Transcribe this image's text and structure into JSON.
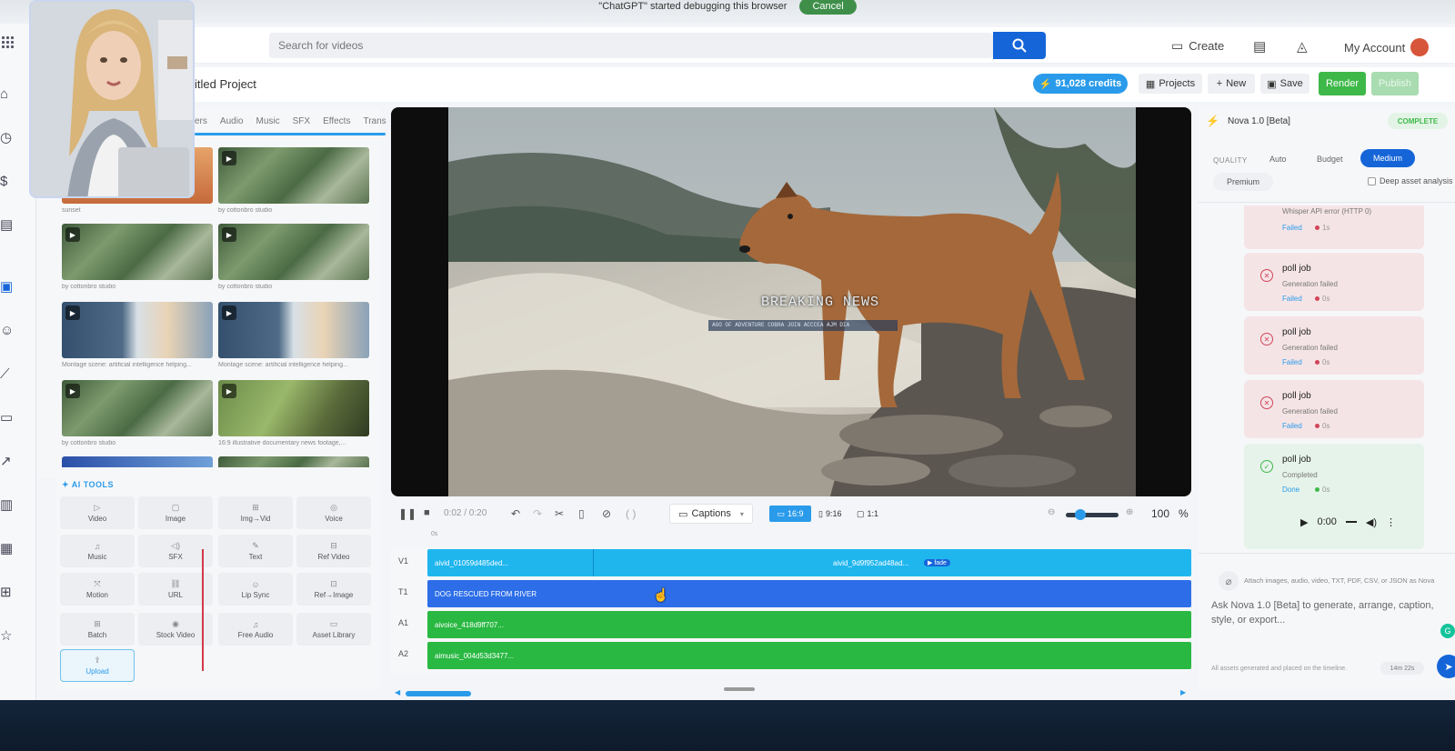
{
  "banner": {
    "text": "\"ChatGPT\" started debugging this browser",
    "cancel": "Cancel"
  },
  "header": {
    "search_placeholder": "Search for videos",
    "create": "Create",
    "my_account": "My Account"
  },
  "project": {
    "title": "itled Project",
    "credits": "91,028 credits",
    "projects": "Projects",
    "new": "New",
    "save": "Save",
    "render": "Render",
    "publish": "Publish"
  },
  "media": {
    "tabs": [
      "ers",
      "Audio",
      "Music",
      "SFX",
      "Effects",
      "Trans"
    ],
    "thumbs": [
      {
        "caption": "sunset"
      },
      {
        "caption": "by cottonbro studio"
      },
      {
        "caption": "by cottonbro studio"
      },
      {
        "caption": "by cottonbro studio"
      },
      {
        "caption": "Montage scene: artificial intelligence helping..."
      },
      {
        "caption": "Montage scene: artificial intelligence helping..."
      },
      {
        "caption": "by cottonbro studio"
      },
      {
        "caption": "16:9 illustrative documentary news footage,..."
      }
    ]
  },
  "ai_tools": {
    "label": "AI TOOLS",
    "tools": [
      {
        "label": "Video",
        "icon": "▷"
      },
      {
        "label": "Image",
        "icon": "▢"
      },
      {
        "label": "Img→Vid",
        "icon": "⊞"
      },
      {
        "label": "Voice",
        "icon": "◎"
      },
      {
        "label": "Music",
        "icon": "♫"
      },
      {
        "label": "SFX",
        "icon": "◁)"
      },
      {
        "label": "Text",
        "icon": "✎"
      },
      {
        "label": "Ref Video",
        "icon": "⊟"
      },
      {
        "label": "Motion",
        "icon": "⤧"
      },
      {
        "label": "URL",
        "icon": "⛓"
      },
      {
        "label": "Lip Sync",
        "icon": "☺"
      },
      {
        "label": "Ref→Image",
        "icon": "⊡"
      },
      {
        "label": "Batch",
        "icon": "⊞"
      },
      {
        "label": "Stock Video",
        "icon": "◉"
      },
      {
        "label": "Free Audio",
        "icon": "♫"
      },
      {
        "label": "Asset Library",
        "icon": "▭"
      }
    ],
    "upload": "Upload"
  },
  "video": {
    "overlay_title": "BREAKING NEWS",
    "overlay_sub": "AGO OF ADVENTURE COBRA JOIN ACCCEA AJM DIA"
  },
  "controls": {
    "time": "0:02 / 0:20",
    "captions": "Captions",
    "ar_169": "16:9",
    "ar_916": "9:16",
    "ar_11": "1:1",
    "zoom": "100",
    "zoom_unit": "%",
    "ruler_start": "0s"
  },
  "timeline": {
    "tracks": [
      {
        "label": "V1",
        "clip": "aivid_01059d485ded...",
        "clip2": "aivid_9d9f952ad48ad...",
        "badge": "fade"
      },
      {
        "label": "T1",
        "clip": "DOG RESCUED FROM RIVER"
      },
      {
        "label": "A1",
        "clip": "aivoice_418d9ff707..."
      },
      {
        "label": "A2",
        "clip": "aimusic_004d53d3477..."
      }
    ]
  },
  "assistant": {
    "name": "Nova 1.0 [Beta]",
    "status": "COMPLETE",
    "quality_label": "QUALITY",
    "quality_options": [
      "Auto",
      "Budget",
      "Medium",
      "Premium"
    ],
    "quality_selected": "Medium",
    "deep_asset": "Deep asset analysis",
    "partial_job": {
      "sub": "Whisper API error (HTTP 0)",
      "status": "Failed",
      "time": "1s"
    },
    "jobs": [
      {
        "title": "poll job",
        "sub": "Generation failed",
        "status": "Failed",
        "time": "0s"
      },
      {
        "title": "poll job",
        "sub": "Generation failed",
        "status": "Failed",
        "time": "0s"
      },
      {
        "title": "poll job",
        "sub": "Generation failed",
        "status": "Failed",
        "time": "0s"
      },
      {
        "title": "poll job",
        "sub": "Completed",
        "status": "Done",
        "time": "0s"
      }
    ],
    "audio_time": "0:00",
    "attach_hint": "Attach images, audio, video, TXT, PDF, CSV, or JSON as Nova",
    "input_placeholder": "Ask Nova 1.0 [Beta] to generate, arrange, caption, style, or export...",
    "footer_note": "All assets generated and placed on the timeline.",
    "elapsed": "14m 22s"
  }
}
